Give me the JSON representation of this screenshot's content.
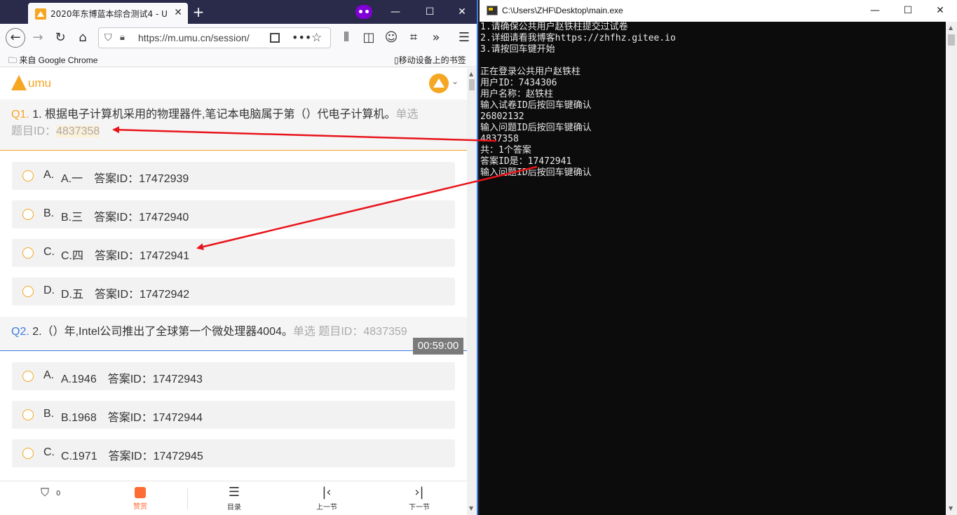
{
  "browser": {
    "tab_title": "2020年东博蓝本综合测试4 - U",
    "tab_close": "✕",
    "new_tab": "+",
    "window_controls": {
      "minimize": "—",
      "maximize": "☐",
      "close": "✕"
    },
    "url": "https://m.umu.cn/session/",
    "bookmarks_left": "来自 Google Chrome",
    "bookmarks_right": "移动设备上的书签"
  },
  "umu": {
    "logo_text": "umu"
  },
  "questions": [
    {
      "number": "Q1.",
      "text": "1. 根据电子计算机采用的物理器件,笔记本电脑属于第（）代电子计算机。",
      "type": "单选",
      "id_label": "题目ID：",
      "id": "4837358",
      "options": [
        {
          "letter": "A.",
          "text": "A.一　答案ID：17472939"
        },
        {
          "letter": "B.",
          "text": "B.三　答案ID：17472940"
        },
        {
          "letter": "C.",
          "text": "C.四　答案ID：17472941"
        },
        {
          "letter": "D.",
          "text": "D.五　答案ID：17472942"
        }
      ]
    },
    {
      "number": "Q2.",
      "text": "2.（）年,Intel公司推出了全球第一个微处理器4004。",
      "type": "单选",
      "id_label": "题目ID：",
      "id": "4837359",
      "options": [
        {
          "letter": "A.",
          "text": "A.1946　答案ID：17472943"
        },
        {
          "letter": "B.",
          "text": "B.1968　答案ID：17472944"
        },
        {
          "letter": "C.",
          "text": "C.1971　答案ID：17472945"
        }
      ]
    }
  ],
  "timer": "00:59:00",
  "bottom_bar": {
    "shield_count": "0",
    "like_label": "赞赏",
    "menu_label": "目录",
    "prev_label": "上一节",
    "next_label": "下一节"
  },
  "console": {
    "title": "C:\\Users\\ZHF\\Desktop\\main.exe",
    "lines": [
      "1.请确保公共用户赵铁柱提交过试卷",
      "2.详细请看我博客https://zhfhz.gitee.io",
      "3.请按回车键开始",
      "",
      "正在登录公共用户赵铁柱",
      "用户ID：7434306",
      "用户名称：赵铁柱",
      "输入试卷ID后按回车键确认",
      "26802132",
      "输入问题ID后按回车键确认",
      "4837358",
      "共：1个答案",
      "答案ID是：17472941",
      "输入问题ID后按回车键确认"
    ]
  },
  "colors": {
    "accent": "#f5a623",
    "arrow": "#e8141b",
    "q2_accent": "#3c7be0"
  }
}
